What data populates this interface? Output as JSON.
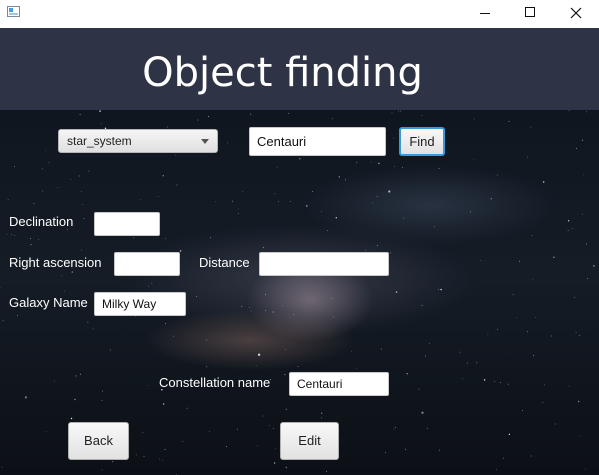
{
  "window": {
    "icon": "app-window-icon",
    "controls": [
      "minimize-icon",
      "maximize-icon",
      "close-icon"
    ]
  },
  "header": {
    "title": "Object finding",
    "background": "#2f3346"
  },
  "search": {
    "type_selected": "star_system",
    "query_value": "Centauri",
    "find_label": "Find"
  },
  "form": {
    "declination_label": "Declination",
    "declination_value": "",
    "right_ascension_label": "Right ascension",
    "right_ascension_value": "",
    "distance_label": "Distance",
    "distance_value": "",
    "galaxy_name_label": "Galaxy Name",
    "galaxy_name_value": "Milky Way",
    "constellation_name_label": "Constellation name",
    "constellation_name_value": "Centauri"
  },
  "actions": {
    "back_label": "Back",
    "edit_label": "Edit"
  },
  "colors": {
    "accent": "#3a9ad9",
    "label_text": "#ffffff"
  }
}
